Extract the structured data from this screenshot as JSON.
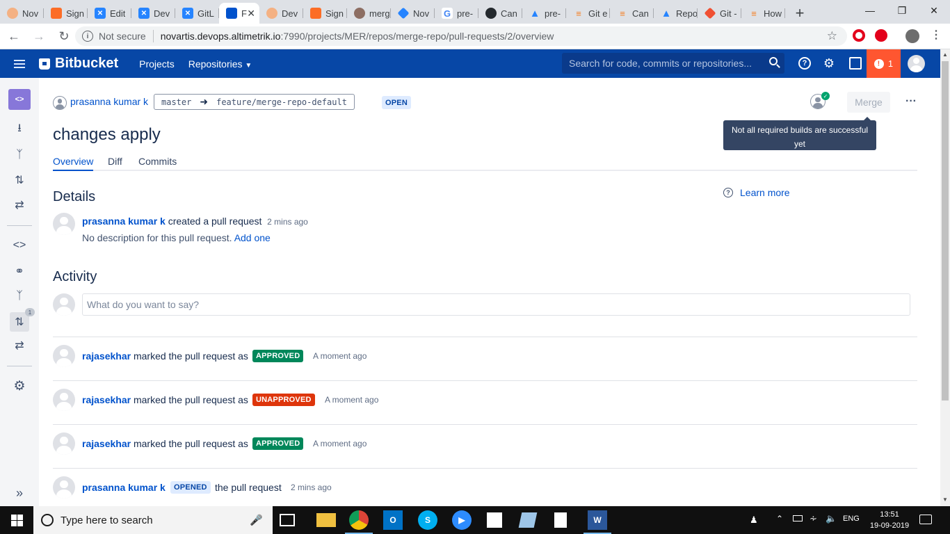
{
  "browser": {
    "tabs": [
      {
        "title": "Nov",
        "color": "#f4b183"
      },
      {
        "title": "Sign",
        "color": "#fc6d26"
      },
      {
        "title": "Edit",
        "color": "#2684ff"
      },
      {
        "title": "Dev",
        "color": "#2684ff"
      },
      {
        "title": "GitL",
        "color": "#2684ff"
      },
      {
        "title": "F",
        "color": "#0052cc"
      },
      {
        "title": "Dev",
        "color": "#f4b183"
      },
      {
        "title": "Sign",
        "color": "#fc6d26"
      },
      {
        "title": "merg",
        "color": "#8d6e63"
      },
      {
        "title": "Nov",
        "color": "#2684ff"
      },
      {
        "title": "pre-",
        "color": "#4285f4"
      },
      {
        "title": "Can",
        "color": "#24292e"
      },
      {
        "title": "pre-",
        "color": "#2684ff"
      },
      {
        "title": "Git e",
        "color": "#f48024"
      },
      {
        "title": "Can",
        "color": "#f48024"
      },
      {
        "title": "Repo",
        "color": "#2684ff"
      },
      {
        "title": "Git -",
        "color": "#f05033"
      },
      {
        "title": "How",
        "color": "#f48024"
      }
    ],
    "not_secure_label": "Not secure",
    "url_host": "novartis.devops.altimetrik.io",
    "url_path": ":7990/projects/MER/repos/merge-repo/pull-requests/2/overview"
  },
  "header": {
    "logo_text": "Bitbucket",
    "projects_label": "Projects",
    "repositories_label": "Repositories",
    "search_placeholder": "Search for code, commits or repositories...",
    "alert_count": "1"
  },
  "sidebar": {
    "pr_badge": "1"
  },
  "pr": {
    "author": "prasanna kumar k",
    "source_branch": "master",
    "target_branch": "feature/merge-repo-default",
    "state": "OPEN",
    "title": "changes apply",
    "merge_label": "Merge",
    "tooltip_line1": "Not all required builds are successful",
    "tooltip_line2": "yet",
    "tabs": {
      "overview": "Overview",
      "diff": "Diff",
      "commits": "Commits"
    }
  },
  "details": {
    "heading": "Details",
    "learn_more": "Learn more",
    "creator": "prasanna kumar k",
    "created_text": "created a pull request",
    "created_time": "2 mins ago",
    "description": "No description for this pull request.",
    "add_one": "Add one"
  },
  "activity": {
    "heading": "Activity",
    "comment_placeholder": "What do you want to say?",
    "items": [
      {
        "user": "rajasekhar",
        "text": "marked the pull request as",
        "status": "APPROVED",
        "time": "A moment ago"
      },
      {
        "user": "rajasekhar",
        "text": "marked the pull request as",
        "status": "UNAPPROVED",
        "time": "A moment ago"
      },
      {
        "user": "rajasekhar",
        "text": "marked the pull request as",
        "status": "APPROVED",
        "time": "A moment ago"
      },
      {
        "user": "prasanna kumar k",
        "status": "OPENED",
        "text": "the pull request",
        "time": "2 mins ago"
      }
    ]
  },
  "taskbar": {
    "search_placeholder": "Type here to search",
    "language": "ENG",
    "time": "13:51",
    "date": "19-09-2019"
  }
}
